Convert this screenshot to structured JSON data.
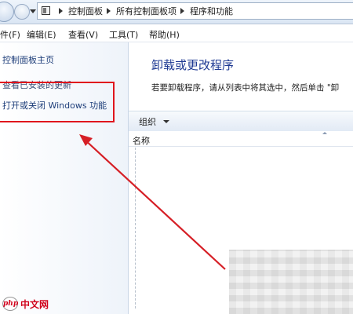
{
  "address_bar": {
    "breadcrumbs": [
      "控制面板",
      "所有控制面板项",
      "程序和功能"
    ]
  },
  "menu": {
    "items": [
      "件(F)",
      "编辑(E)",
      "查看(V)",
      "工具(T)",
      "帮助(H)"
    ]
  },
  "sidebar": {
    "items": [
      {
        "label": "控制面板主页"
      },
      {
        "label": "查看已安装的更新"
      },
      {
        "label": "打开或关闭 Windows 功能"
      }
    ]
  },
  "main": {
    "title": "卸载或更改程序",
    "description": "若要卸载程序，请从列表中将其选中，然后单击 \"卸"
  },
  "toolbar": {
    "organize_label": "组织"
  },
  "list": {
    "columns": [
      "名称"
    ]
  },
  "watermark": {
    "logo_text": "php",
    "text": "中文网"
  },
  "colors": {
    "highlight_red": "#e0141d",
    "link_blue": "#1e3e7a",
    "title_blue": "#1f3a93"
  }
}
